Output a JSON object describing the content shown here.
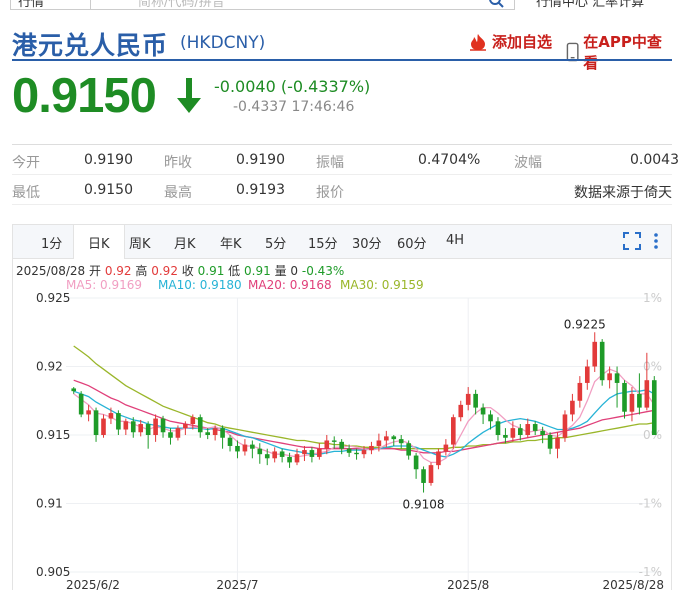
{
  "topbar": {
    "category": "行情",
    "search_placeholder": "简称/代码/拼音",
    "links": "行情中心  汇率计算"
  },
  "header": {
    "title_cn": "港元兑人民币",
    "code": "(HKDCNY)",
    "add_fav": "添加自选",
    "open_app": "在APP中查看"
  },
  "quote": {
    "price": "0.9150",
    "change": "-0.0040 (-0.4337%)",
    "sub": "-0.4337 17:46:46"
  },
  "stats": {
    "open_label": "今开",
    "open": "0.9190",
    "prev_label": "昨收",
    "prev": "0.9190",
    "amp_label": "振幅",
    "amp": "0.4704%",
    "wave_label": "波幅",
    "wave": "0.0043",
    "low_label": "最低",
    "low": "0.9150",
    "high_label": "最高",
    "high": "0.9193",
    "quote_label": "报价",
    "source": "数据来源于倚天"
  },
  "tabs": [
    "1分",
    "日K",
    "周K",
    "月K",
    "年K",
    "5分",
    "15分",
    "30分",
    "60分",
    "4H"
  ],
  "info": {
    "date": "2025/08/28",
    "open_lbl": "开",
    "open": "0.92",
    "high_lbl": "高",
    "high": "0.92",
    "close_lbl": "收",
    "close": "0.91",
    "low_lbl": "低",
    "low": "0.91",
    "vol_lbl": "量",
    "vol": "0",
    "chg": "-0.43%"
  },
  "ma_labels": {
    "ma5": "MA5: 0.9169",
    "ma10": "MA10: 0.9180",
    "ma20": "MA20: 0.9168",
    "ma30": "MA30: 0.9159"
  },
  "colors": {
    "up": "#e23a3a",
    "down": "#1e9b28",
    "ma5": "#f19ec2",
    "ma10": "#27b3d6",
    "ma20": "#e0407a",
    "ma30": "#9ab62a",
    "title": "#2a5ea8",
    "price": "#1e8c24"
  },
  "chart_data": {
    "type": "candlestick",
    "y_ticks": [
      "0.925",
      "0.92",
      "0.915",
      "0.91",
      "0.905"
    ],
    "y_values": [
      0.925,
      0.92,
      0.915,
      0.91,
      0.905
    ],
    "ylim": [
      0.905,
      0.925
    ],
    "pct_ticks": [
      "1%",
      "0%",
      "0%",
      "-1%",
      "-1%"
    ],
    "x_ticks": [
      "2025/6/2",
      "2025/7",
      "2025/8",
      "2025/8/28"
    ],
    "annotations": [
      {
        "label": "0.9225",
        "value": 0.9225
      },
      {
        "label": "0.9108",
        "value": 0.9108
      }
    ],
    "candles": [
      [
        0.9184,
        0.9182,
        0.9185,
        0.918
      ],
      [
        0.918,
        0.9165,
        0.9182,
        0.9163
      ],
      [
        0.9165,
        0.9168,
        0.9172,
        0.916
      ],
      [
        0.9168,
        0.915,
        0.917,
        0.9145
      ],
      [
        0.915,
        0.9162,
        0.9165,
        0.9148
      ],
      [
        0.9162,
        0.9166,
        0.917,
        0.9158
      ],
      [
        0.9166,
        0.9154,
        0.9168,
        0.915
      ],
      [
        0.9154,
        0.916,
        0.9162,
        0.915
      ],
      [
        0.916,
        0.9152,
        0.9163,
        0.9148
      ],
      [
        0.9152,
        0.9158,
        0.9161,
        0.9149
      ],
      [
        0.9158,
        0.915,
        0.916,
        0.914
      ],
      [
        0.915,
        0.9162,
        0.9165,
        0.9145
      ],
      [
        0.9162,
        0.9152,
        0.9164,
        0.9148
      ],
      [
        0.9152,
        0.9148,
        0.9155,
        0.9143
      ],
      [
        0.9148,
        0.9155,
        0.9157,
        0.9146
      ],
      [
        0.9155,
        0.9158,
        0.916,
        0.915
      ],
      [
        0.9158,
        0.9163,
        0.9165,
        0.9154
      ],
      [
        0.9163,
        0.9152,
        0.9165,
        0.9148
      ],
      [
        0.9152,
        0.915,
        0.9155,
        0.9147
      ],
      [
        0.915,
        0.9155,
        0.9157,
        0.9146
      ],
      [
        0.9155,
        0.9148,
        0.9157,
        0.914
      ],
      [
        0.9148,
        0.9142,
        0.915,
        0.9138
      ],
      [
        0.9142,
        0.9138,
        0.9146,
        0.9133
      ],
      [
        0.9138,
        0.9143,
        0.9147,
        0.9135
      ],
      [
        0.9143,
        0.914,
        0.9146,
        0.9133
      ],
      [
        0.914,
        0.9136,
        0.9144,
        0.9129
      ],
      [
        0.9136,
        0.9133,
        0.914,
        0.9128
      ],
      [
        0.9133,
        0.9138,
        0.9141,
        0.913
      ],
      [
        0.9138,
        0.9134,
        0.914,
        0.913
      ],
      [
        0.9134,
        0.913,
        0.9137,
        0.9126
      ],
      [
        0.913,
        0.9136,
        0.914,
        0.9128
      ],
      [
        0.9136,
        0.9139,
        0.9142,
        0.9131
      ],
      [
        0.9139,
        0.9134,
        0.9141,
        0.913
      ],
      [
        0.9134,
        0.914,
        0.9144,
        0.9132
      ],
      [
        0.914,
        0.9146,
        0.915,
        0.9136
      ],
      [
        0.9146,
        0.9145,
        0.9149,
        0.914
      ],
      [
        0.9145,
        0.914,
        0.9147,
        0.9136
      ],
      [
        0.914,
        0.9137,
        0.9143,
        0.9134
      ],
      [
        0.9137,
        0.9136,
        0.914,
        0.9132
      ],
      [
        0.9136,
        0.9139,
        0.9142,
        0.9133
      ],
      [
        0.9139,
        0.9142,
        0.9145,
        0.9136
      ],
      [
        0.9142,
        0.9146,
        0.9151,
        0.9138
      ],
      [
        0.9146,
        0.9149,
        0.9153,
        0.9141
      ],
      [
        0.9149,
        0.9147,
        0.915,
        0.9142
      ],
      [
        0.9147,
        0.9144,
        0.915,
        0.914
      ],
      [
        0.9144,
        0.9135,
        0.9146,
        0.9132
      ],
      [
        0.9135,
        0.9125,
        0.9137,
        0.9118
      ],
      [
        0.9125,
        0.9115,
        0.9127,
        0.9108
      ],
      [
        0.9115,
        0.9128,
        0.913,
        0.9113
      ],
      [
        0.9128,
        0.9138,
        0.914,
        0.9125
      ],
      [
        0.9138,
        0.9143,
        0.9147,
        0.9135
      ],
      [
        0.9143,
        0.9163,
        0.9165,
        0.914
      ],
      [
        0.9163,
        0.9172,
        0.9175,
        0.916
      ],
      [
        0.9172,
        0.918,
        0.9185,
        0.9168
      ],
      [
        0.918,
        0.917,
        0.9183,
        0.9165
      ],
      [
        0.917,
        0.9165,
        0.9173,
        0.9158
      ],
      [
        0.9165,
        0.916,
        0.9168,
        0.9154
      ],
      [
        0.916,
        0.915,
        0.9163,
        0.9146
      ],
      [
        0.915,
        0.9148,
        0.9155,
        0.9144
      ],
      [
        0.9148,
        0.9155,
        0.916,
        0.9145
      ],
      [
        0.9155,
        0.915,
        0.9158,
        0.9146
      ],
      [
        0.915,
        0.9158,
        0.9162,
        0.9148
      ],
      [
        0.9158,
        0.9153,
        0.916,
        0.915
      ],
      [
        0.9153,
        0.915,
        0.9156,
        0.9144
      ],
      [
        0.915,
        0.914,
        0.9152,
        0.9136
      ],
      [
        0.914,
        0.9148,
        0.9152,
        0.9133
      ],
      [
        0.9148,
        0.9165,
        0.9168,
        0.9145
      ],
      [
        0.9165,
        0.9175,
        0.918,
        0.916
      ],
      [
        0.9175,
        0.9188,
        0.9193,
        0.917
      ],
      [
        0.9188,
        0.92,
        0.9205,
        0.9183
      ],
      [
        0.92,
        0.9218,
        0.9225,
        0.9196
      ],
      [
        0.9218,
        0.919,
        0.922,
        0.9186
      ],
      [
        0.919,
        0.9195,
        0.92,
        0.9184
      ],
      [
        0.9195,
        0.9188,
        0.92,
        0.917
      ],
      [
        0.9188,
        0.9167,
        0.919,
        0.9162
      ],
      [
        0.9167,
        0.918,
        0.9185,
        0.916
      ],
      [
        0.918,
        0.917,
        0.9195,
        0.9165
      ],
      [
        0.917,
        0.919,
        0.921,
        0.9168
      ],
      [
        0.919,
        0.915,
        0.9193,
        0.915
      ]
    ],
    "ma5": [
      0.918,
      0.9176,
      0.9172,
      0.9166,
      0.9165,
      0.9163,
      0.916,
      0.916,
      0.9158,
      0.9156,
      0.9154,
      0.9156,
      0.9155,
      0.9153,
      0.9153,
      0.9155,
      0.9156,
      0.9155,
      0.9155,
      0.9156,
      0.9154,
      0.915,
      0.9145,
      0.9142,
      0.9142,
      0.914,
      0.9138,
      0.9136,
      0.9136,
      0.9135,
      0.9134,
      0.9135,
      0.9136,
      0.9137,
      0.9138,
      0.9141,
      0.9141,
      0.9142,
      0.9141,
      0.914,
      0.9139,
      0.914,
      0.9143,
      0.9145,
      0.9146,
      0.9144,
      0.914,
      0.9133,
      0.913,
      0.913,
      0.9133,
      0.914,
      0.915,
      0.916,
      0.9166,
      0.917,
      0.917,
      0.9166,
      0.9161,
      0.9157,
      0.9155,
      0.9152,
      0.9153,
      0.9154,
      0.915,
      0.9149,
      0.9153,
      0.9157,
      0.9163,
      0.9175,
      0.9189,
      0.9194,
      0.9198,
      0.9196,
      0.919,
      0.9186,
      0.918,
      0.918,
      0.9172
    ],
    "ma10": [
      0.9182,
      0.918,
      0.9178,
      0.9174,
      0.9171,
      0.9168,
      0.9165,
      0.9163,
      0.9161,
      0.916,
      0.9158,
      0.9157,
      0.9156,
      0.9155,
      0.9155,
      0.9155,
      0.9155,
      0.9155,
      0.9154,
      0.9155,
      0.9155,
      0.9153,
      0.9151,
      0.9149,
      0.9148,
      0.9146,
      0.9144,
      0.9142,
      0.914,
      0.9139,
      0.9138,
      0.9137,
      0.9136,
      0.9136,
      0.9137,
      0.9138,
      0.9138,
      0.9139,
      0.9139,
      0.9139,
      0.914,
      0.914,
      0.9141,
      0.9142,
      0.9142,
      0.9142,
      0.9141,
      0.9139,
      0.9137,
      0.9135,
      0.9134,
      0.9136,
      0.9139,
      0.9144,
      0.9148,
      0.9152,
      0.9155,
      0.9158,
      0.916,
      0.9161,
      0.9162,
      0.9161,
      0.916,
      0.9158,
      0.9156,
      0.9154,
      0.9154,
      0.9155,
      0.9157,
      0.916,
      0.9166,
      0.9172,
      0.9177,
      0.918,
      0.9181,
      0.9182,
      0.9182,
      0.9183,
      0.918
    ],
    "ma20": [
      0.919,
      0.9188,
      0.9186,
      0.9183,
      0.918,
      0.9177,
      0.9175,
      0.9172,
      0.917,
      0.9168,
      0.9166,
      0.9164,
      0.9162,
      0.916,
      0.9159,
      0.9158,
      0.9157,
      0.9156,
      0.9155,
      0.9154,
      0.9153,
      0.9152,
      0.915,
      0.9149,
      0.9148,
      0.9147,
      0.9146,
      0.9145,
      0.9144,
      0.9143,
      0.9142,
      0.9141,
      0.9141,
      0.914,
      0.914,
      0.914,
      0.914,
      0.914,
      0.914,
      0.914,
      0.914,
      0.914,
      0.914,
      0.914,
      0.9139,
      0.9139,
      0.9138,
      0.9137,
      0.9137,
      0.9137,
      0.9138,
      0.9138,
      0.9139,
      0.914,
      0.9141,
      0.9142,
      0.9143,
      0.9144,
      0.9145,
      0.9146,
      0.9147,
      0.9148,
      0.9149,
      0.915,
      0.9151,
      0.9152,
      0.9153,
      0.9154,
      0.9155,
      0.9157,
      0.9159,
      0.9161,
      0.9162,
      0.9163,
      0.9164,
      0.9165,
      0.9166,
      0.9167,
      0.9168
    ],
    "ma30": [
      0.9215,
      0.9211,
      0.9207,
      0.9202,
      0.9198,
      0.9194,
      0.919,
      0.9186,
      0.9183,
      0.918,
      0.9177,
      0.9174,
      0.9171,
      0.9169,
      0.9167,
      0.9165,
      0.9163,
      0.9161,
      0.9159,
      0.9158,
      0.9156,
      0.9155,
      0.9154,
      0.9153,
      0.9152,
      0.9151,
      0.915,
      0.9149,
      0.9148,
      0.9147,
      0.9146,
      0.9146,
      0.9145,
      0.9144,
      0.9144,
      0.9143,
      0.9143,
      0.9142,
      0.9142,
      0.9141,
      0.9141,
      0.9141,
      0.9141,
      0.914,
      0.914,
      0.914,
      0.914,
      0.914,
      0.914,
      0.914,
      0.914,
      0.9141,
      0.9141,
      0.9142,
      0.9142,
      0.9143,
      0.9143,
      0.9144,
      0.9144,
      0.9145,
      0.9145,
      0.9146,
      0.9146,
      0.9147,
      0.9147,
      0.9148,
      0.9148,
      0.9149,
      0.915,
      0.9151,
      0.9152,
      0.9153,
      0.9154,
      0.9155,
      0.9156,
      0.9157,
      0.9158,
      0.9158,
      0.9159
    ]
  }
}
